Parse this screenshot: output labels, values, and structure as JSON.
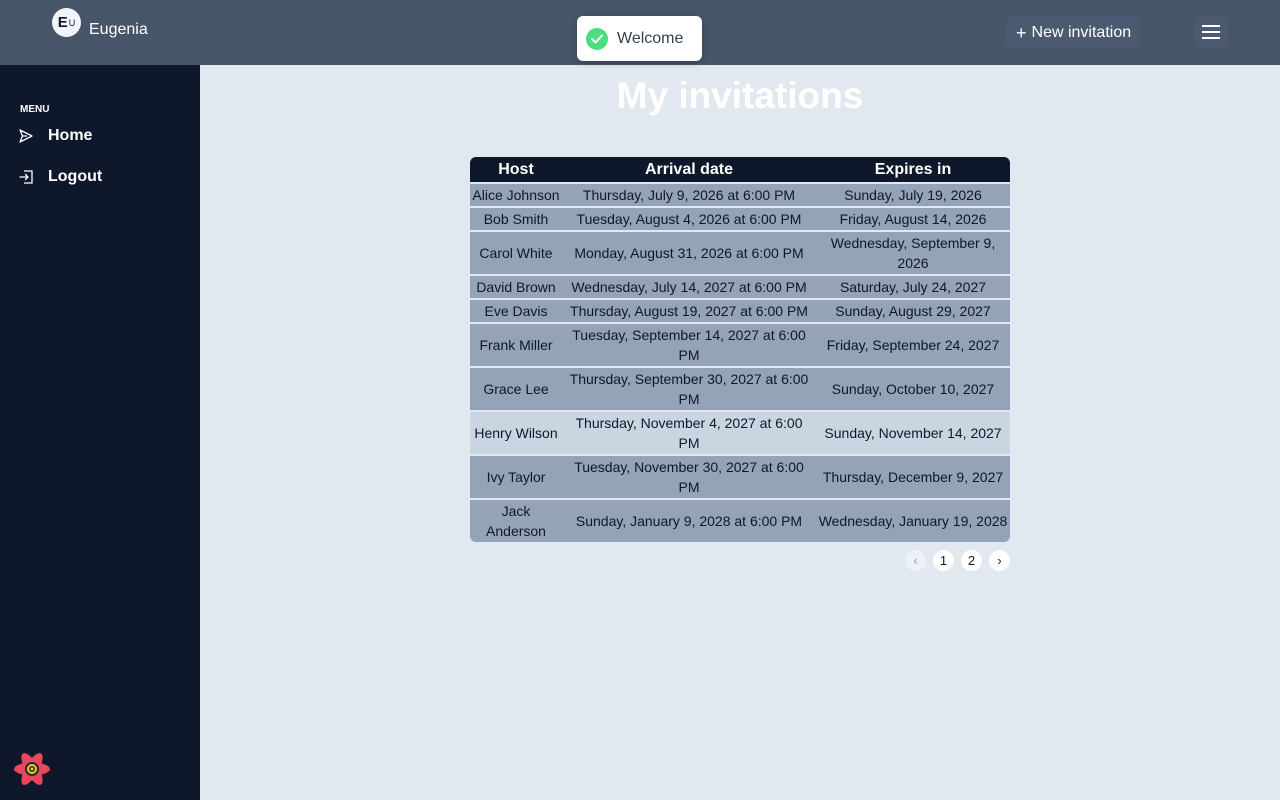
{
  "brand": {
    "name": "Eugenia",
    "logo_letter": "E",
    "logo_sup": "U"
  },
  "toast": {
    "text": "Welcome"
  },
  "header": {
    "new_invitation_label": "New invitation",
    "plus": "+"
  },
  "sidebar": {
    "menu_title": "MENU",
    "items": [
      {
        "label": "Home",
        "icon": "send-icon"
      },
      {
        "label": "Logout",
        "icon": "logout-icon"
      }
    ]
  },
  "main": {
    "title": "My invitations",
    "columns": [
      "Host",
      "Arrival date",
      "Expires in"
    ],
    "rows": [
      {
        "host": "Alice Johnson",
        "arrival": "Thursday, July 9, 2026 at 6:00 PM",
        "expires": "Sunday, July 19, 2026"
      },
      {
        "host": "Bob Smith",
        "arrival": "Tuesday, August 4, 2026 at 6:00 PM",
        "expires": "Friday, August 14, 2026"
      },
      {
        "host": "Carol White",
        "arrival": "Monday, August 31, 2026 at 6:00 PM",
        "expires": "Wednesday, September 9, 2026"
      },
      {
        "host": "David Brown",
        "arrival": "Wednesday, July 14, 2027 at 6:00 PM",
        "expires": "Saturday, July 24, 2027"
      },
      {
        "host": "Eve Davis",
        "arrival": "Thursday, August 19, 2027 at 6:00 PM",
        "expires": "Sunday, August 29, 2027"
      },
      {
        "host": "Frank Miller",
        "arrival": "Tuesday, September 14, 2027 at 6:00 PM",
        "expires": "Friday, September 24, 2027"
      },
      {
        "host": "Grace Lee",
        "arrival": "Thursday, September 30, 2027 at 6:00 PM",
        "expires": "Sunday, October 10, 2027"
      },
      {
        "host": "Henry Wilson",
        "arrival": "Thursday, November 4, 2027 at 6:00 PM",
        "expires": "Sunday, November 14, 2027"
      },
      {
        "host": "Ivy Taylor",
        "arrival": "Tuesday, November 30, 2027 at 6:00 PM",
        "expires": "Thursday, December 9, 2027"
      },
      {
        "host": "Jack Anderson",
        "arrival": "Sunday, January 9, 2028 at 6:00 PM",
        "expires": "Wednesday, January 19, 2028"
      }
    ],
    "highlighted_row": "Henry Wilson"
  },
  "pagination": {
    "prev": "‹",
    "pages": [
      "1",
      "2"
    ],
    "next": "›"
  },
  "colors": {
    "topbar": "#475569",
    "sidebar": "#0f172a",
    "background": "#e2e8f0",
    "row": "#94a3b8",
    "row_highlight": "#cbd5e1",
    "toast_check": "#4ade80",
    "react_logo": "#e8485c"
  }
}
